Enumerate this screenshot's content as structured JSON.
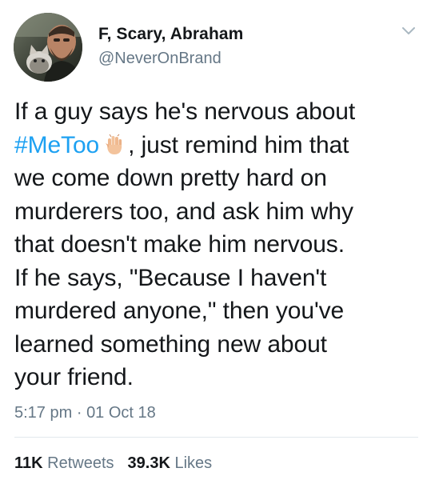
{
  "user": {
    "display_name": "F, Scary, Abraham",
    "handle": "@NeverOnBrand"
  },
  "tweet": {
    "lines": [
      {
        "text": "If a guy says he's nervous about"
      },
      {
        "hashtag": "#MeToo",
        "emoji": "raised-hand-emoji",
        "rest": ", just remind him that"
      },
      {
        "text": "we come down pretty hard on"
      },
      {
        "text": "murderers too, and ask him why"
      },
      {
        "text": "that doesn't make him nervous."
      },
      {
        "text": "If he says, \"Because I haven't"
      },
      {
        "text": "murdered anyone,\" then you've"
      },
      {
        "text": "learned something new about"
      },
      {
        "text": "your friend."
      }
    ],
    "time": "5:17 pm",
    "separator": "·",
    "date": "01 Oct 18"
  },
  "stats": {
    "retweets_count": "11K",
    "retweets_label": "Retweets",
    "likes_count": "39.3K",
    "likes_label": "Likes"
  },
  "icons": {
    "avatar": "profile-photo",
    "caret": "chevron-down-icon",
    "emoji": "raised-hand-emoji"
  },
  "colors": {
    "hashtag": "#1da1f2",
    "secondary_text": "#657786",
    "primary_text": "#14171a",
    "divider": "#e1e8ed"
  }
}
